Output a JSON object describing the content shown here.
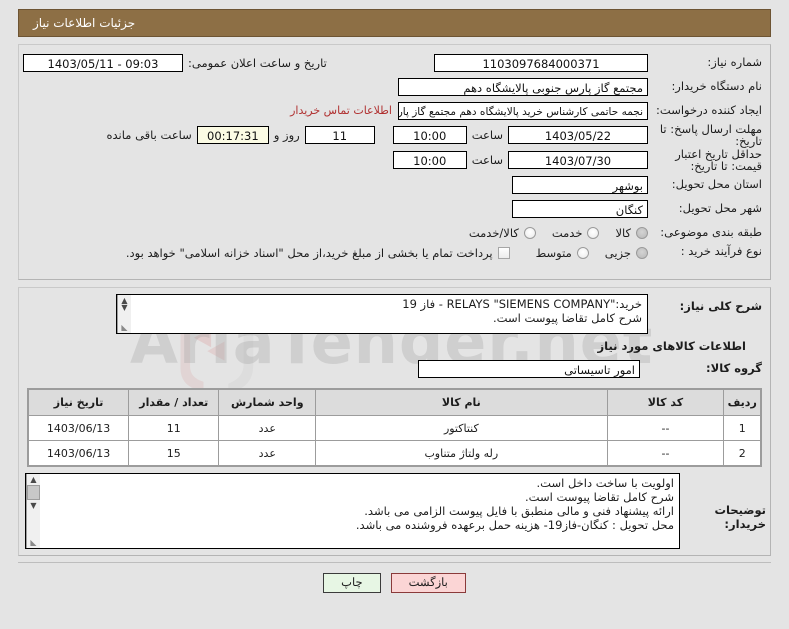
{
  "window": {
    "title": "جزئیات اطلاعات نیاز",
    "title_bar_color": "#8d6f45"
  },
  "watermark": {
    "text": "AriaTender.net"
  },
  "form": {
    "need_number": {
      "label": "شماره نیاز:",
      "value": "1103097684000371"
    },
    "announce_datetime": {
      "label": "تاریخ و ساعت اعلان عمومی:",
      "value": "09:03 - 1403/05/11"
    },
    "buyer_org": {
      "label": "نام دستگاه خریدار:",
      "value": "مجتمع گاز پارس جنوبی  پالایشگاه دهم"
    },
    "request_creator": {
      "label": "ایجاد کننده درخواست:",
      "value": "نجمه حاتمی کارشناس خرید پالایشگاه دهم  مجتمع گاز پارس جنوبی  پالایشگاه",
      "contact_link": "اطلاعات تماس خریدار"
    },
    "response_deadline": {
      "label": "مهلت ارسال پاسخ: تا تاریخ:",
      "date": "1403/05/22",
      "time_label": "ساعت",
      "time": "10:00",
      "days": "11",
      "days_label": "روز و",
      "remaining": "00:17:31",
      "remaining_label": "ساعت باقی مانده"
    },
    "price_validity": {
      "label": "حداقل تاریخ اعتبار قیمت: تا تاریخ:",
      "date": "1403/07/30",
      "time_label": "ساعت",
      "time": "10:00"
    },
    "delivery_province": {
      "label": "استان محل تحویل:",
      "value": "بوشهر"
    },
    "delivery_city": {
      "label": "شهر محل تحویل:",
      "value": "کنگان"
    },
    "subject_category": {
      "label": "طبقه بندی موضوعی:",
      "options": [
        {
          "label": "کالا",
          "selected": true
        },
        {
          "label": "خدمت",
          "selected": false
        },
        {
          "label": "کالا/خدمت",
          "selected": false
        }
      ]
    },
    "purchase_process": {
      "label": "نوع فرآیند خرید :",
      "options": [
        {
          "label": "جزیی",
          "selected": true
        },
        {
          "label": "متوسط",
          "selected": false
        }
      ],
      "checkbox_label": "پرداخت تمام یا بخشی از مبلغ خرید،از محل \"اسناد خزانه اسلامی\" خواهد بود.",
      "checkbox_checked": false
    },
    "general_description": {
      "label": "شرح کلی نیاز:",
      "lines": [
        "خرید:\"RELAYS \"SIEMENS COMPANY - فاز 19",
        "شرح کامل تقاضا پیوست است."
      ]
    },
    "goods_section_title": "اطلاعات کالاهای مورد نیاز",
    "goods_group": {
      "label": "گروه کالا:",
      "value": "امور تاسیساتی"
    },
    "buyer_notes": {
      "label": "توضیحات خریدار:",
      "lines": [
        "اولویت با ساخت داخل است.",
        "شرح کامل تقاضا پیوست است.",
        "ارائه پیشنهاد فنی و مالی منطبق با فایل پیوست الزامی می باشد.",
        "محل تحویل : کنگان-فاز19- هزینه حمل برعهده فروشنده می باشد."
      ]
    }
  },
  "goods_table": {
    "headers": [
      "ردیف",
      "کد کالا",
      "نام کالا",
      "واحد شمارش",
      "تعداد / مقدار",
      "تاریخ نیاز"
    ],
    "rows": [
      {
        "radif": "1",
        "code": "--",
        "name": "کنتاکتور",
        "unit": "عدد",
        "qty": "11",
        "date": "1403/06/13"
      },
      {
        "radif": "2",
        "code": "--",
        "name": "رله ولتاژ متناوب",
        "unit": "عدد",
        "qty": "15",
        "date": "1403/06/13"
      }
    ]
  },
  "footer": {
    "back_button": "بازگشت",
    "print_button": "چاپ"
  }
}
